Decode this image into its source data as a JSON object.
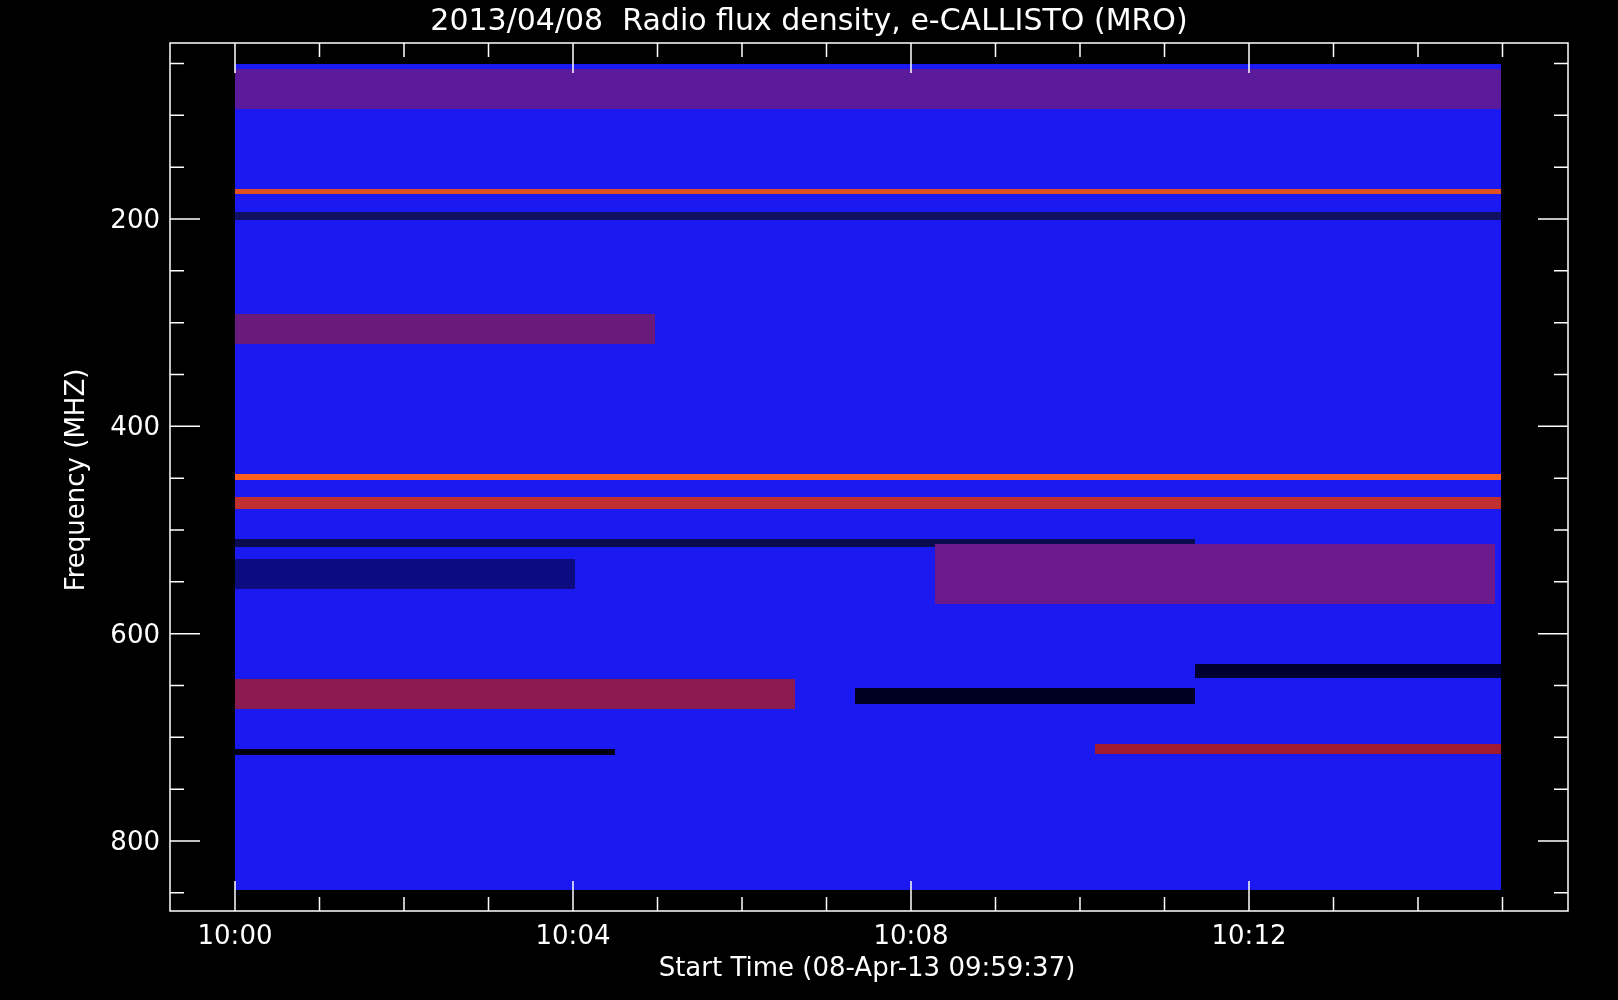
{
  "title": "2013/04/08  Radio flux density, e-CALLISTO (MRO)",
  "plot": {
    "ylabel": "Frequency (MHZ)",
    "xlabel": "Start Time (08-Apr-13 09:59:37)",
    "yticks": [
      "200",
      "400",
      "600",
      "800"
    ],
    "xticks": [
      "10:00",
      "10:04",
      "10:08",
      "10:12"
    ]
  }
}
